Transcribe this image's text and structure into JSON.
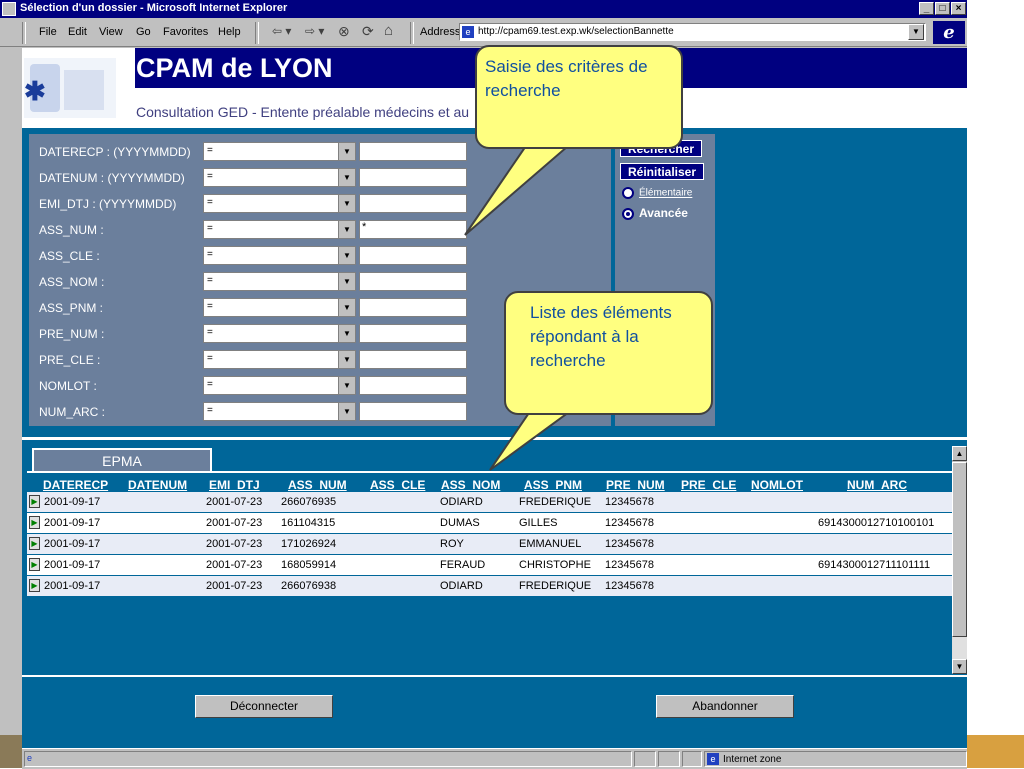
{
  "window": {
    "title": "Sélection d'un dossier - Microsoft Internet Explorer",
    "min_label": "_",
    "max_label": "□",
    "close_label": "×"
  },
  "menu": [
    {
      "label": "File",
      "accel": "F"
    },
    {
      "label": "Edit",
      "accel": "E"
    },
    {
      "label": "View",
      "accel": "V"
    },
    {
      "label": "Go",
      "accel": "G"
    },
    {
      "label": "Favorites",
      "accel": "a"
    },
    {
      "label": "Help",
      "accel": "H"
    }
  ],
  "toolbar": {
    "back": "⇦ ▾",
    "forward": "⇨ ▾",
    "stop": "⊗",
    "refresh": "⟳",
    "home": "⌂",
    "address_label": "Address",
    "url": "http://cpam69.test.exp.wk/selectionBannette"
  },
  "header": {
    "title": "CPAM de LYON",
    "subtitle": "Consultation GED - Entente préalable médecins et au"
  },
  "criteria": [
    {
      "label": "DATERECP : (YYYYMMDD)",
      "op": "=",
      "value": ""
    },
    {
      "label": "DATENUM :  (YYYYMMDD)",
      "op": "=",
      "value": ""
    },
    {
      "label": "EMI_DTJ :     (YYYYMMDD)",
      "op": "=",
      "value": ""
    },
    {
      "label": "ASS_NUM :",
      "op": "=",
      "value": "*"
    },
    {
      "label": "ASS_CLE :",
      "op": "=",
      "value": ""
    },
    {
      "label": "ASS_NOM :",
      "op": "=",
      "value": ""
    },
    {
      "label": "ASS_PNM :",
      "op": "=",
      "value": ""
    },
    {
      "label": "PRE_NUM :",
      "op": "=",
      "value": ""
    },
    {
      "label": "PRE_CLE :",
      "op": "=",
      "value": ""
    },
    {
      "label": "NOMLOT :",
      "op": "=",
      "value": ""
    },
    {
      "label": "NUM_ARC :",
      "op": "=",
      "value": ""
    }
  ],
  "actions": {
    "search": "Rechercher",
    "reset": "Réinitialiser",
    "mode_basic": "Élémentaire",
    "mode_advanced": "Avancée"
  },
  "results": {
    "tab": "EPMA",
    "columns": [
      "DATERECP",
      "DATENUM",
      "EMI_DTJ",
      "ASS_NUM",
      "ASS_CLE",
      "ASS_NOM",
      "ASS_PNM",
      "PRE_NUM",
      "PRE_CLE",
      "NOMLOT",
      "NUM_ARC"
    ],
    "rows": [
      {
        "daterecp": "2001-09-17",
        "datenum": "",
        "emi_dtj": "2001-07-23",
        "ass_num": "266076935",
        "ass_cle": "",
        "ass_nom": "ODIARD",
        "ass_pnm": "FREDERIQUE",
        "pre_num": "12345678",
        "pre_cle": "",
        "nomlot": "",
        "num_arc": ""
      },
      {
        "daterecp": "2001-09-17",
        "datenum": "",
        "emi_dtj": "2001-07-23",
        "ass_num": "161104315",
        "ass_cle": "",
        "ass_nom": "DUMAS",
        "ass_pnm": "GILLES",
        "pre_num": "12345678",
        "pre_cle": "",
        "nomlot": "",
        "num_arc": "6914300012710100101"
      },
      {
        "daterecp": "2001-09-17",
        "datenum": "",
        "emi_dtj": "2001-07-23",
        "ass_num": "171026924",
        "ass_cle": "",
        "ass_nom": "ROY",
        "ass_pnm": "EMMANUEL",
        "pre_num": "12345678",
        "pre_cle": "",
        "nomlot": "",
        "num_arc": ""
      },
      {
        "daterecp": "2001-09-17",
        "datenum": "",
        "emi_dtj": "2001-07-23",
        "ass_num": "168059914",
        "ass_cle": "",
        "ass_nom": "FERAUD",
        "ass_pnm": "CHRISTOPHE",
        "pre_num": "12345678",
        "pre_cle": "",
        "nomlot": "",
        "num_arc": "6914300012711101111"
      },
      {
        "daterecp": "2001-09-17",
        "datenum": "",
        "emi_dtj": "2001-07-23",
        "ass_num": "266076938",
        "ass_cle": "",
        "ass_nom": "ODIARD",
        "ass_pnm": "FREDERIQUE",
        "pre_num": "12345678",
        "pre_cle": "",
        "nomlot": "",
        "num_arc": ""
      }
    ]
  },
  "buttons": {
    "disconnect": "Déconnecter",
    "abandon": "Abandonner"
  },
  "status": {
    "zone": "Internet zone"
  },
  "callouts": {
    "criteria": "Saisie des critères de recherche",
    "results": "Liste des éléments répondant à la recherche"
  }
}
